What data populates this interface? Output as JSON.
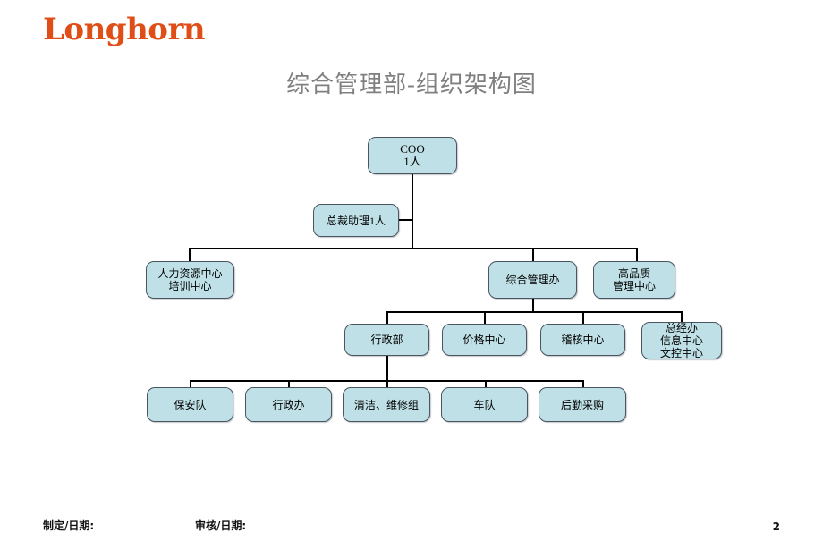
{
  "slide": {
    "logo": "Longhorn",
    "title": "综合管理部-组织架构图",
    "page_number": "2",
    "accent_color": "#E04E17",
    "node_fill_color": "#bfe0e6",
    "node_border_color": "#4a5560",
    "title_color": "#7f7f7f"
  },
  "footer": {
    "made_label": "制定/日期:",
    "check_label": "审核/日期:"
  },
  "org_chart": {
    "level1": {
      "coo": {
        "line1": "COO",
        "line2": "1人"
      }
    },
    "staff": {
      "assistant": {
        "line1": "总裁助理1人"
      }
    },
    "level2": {
      "hr": {
        "line1": "人力资源中心",
        "line2": "培训中心"
      },
      "ga_office": {
        "line1": "综合管理办"
      },
      "quality": {
        "line1": "高品质",
        "line2": "管理中心"
      }
    },
    "level3": {
      "admin_dept": {
        "line1": "行政部"
      },
      "price_center": {
        "line1": "价格中心"
      },
      "audit_center": {
        "line1": "稽核中心"
      },
      "gm_office": {
        "line1": "总经办",
        "line2": "信息中心",
        "line3": "文控中心"
      }
    },
    "level4": {
      "security": {
        "line1": "保安队"
      },
      "admin_office": {
        "line1": "行政办"
      },
      "cleaning_repair": {
        "line1": "清洁、维修组"
      },
      "fleet": {
        "line1": "车队"
      },
      "logistics_purchase": {
        "line1": "后勤采购"
      }
    }
  }
}
